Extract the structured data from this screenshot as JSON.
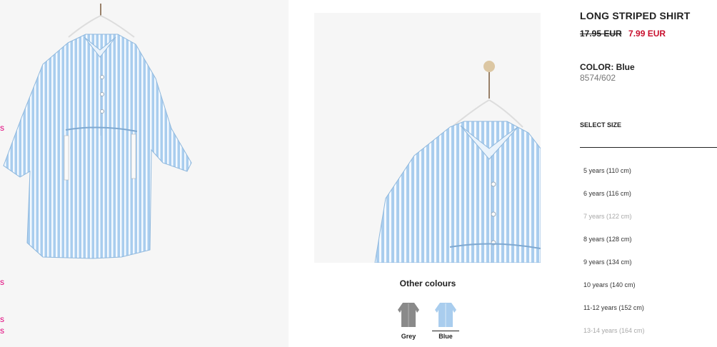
{
  "left_edge_links": [
    "s",
    "s",
    "s",
    "s"
  ],
  "product": {
    "title": "LONG STRIPED SHIRT",
    "old_price": "17.95 EUR",
    "new_price": "7.99 EUR",
    "color_label": "COLOR: Blue",
    "reference": "8574/602"
  },
  "other_colours": {
    "title": "Other colours",
    "options": [
      {
        "label": "Grey",
        "selected": false
      },
      {
        "label": "Blue",
        "selected": true
      }
    ]
  },
  "size": {
    "title": "SELECT SIZE",
    "options": [
      {
        "label": "5 years (110 cm)",
        "available": true
      },
      {
        "label": "6 years (116 cm)",
        "available": true
      },
      {
        "label": "7 years (122 cm)",
        "available": false
      },
      {
        "label": "8 years (128 cm)",
        "available": true
      },
      {
        "label": "9 years (134 cm)",
        "available": true
      },
      {
        "label": "10 years (140 cm)",
        "available": true
      },
      {
        "label": "11-12 years (152 cm)",
        "available": true
      },
      {
        "label": "13-14 years (164 cm)",
        "available": false
      }
    ]
  },
  "colors": {
    "shirt_blue": "#a9cdee",
    "stripe_white": "#f4f9fe",
    "sale_red": "#c8102e",
    "link_pink": "#e0007a",
    "grey_swatch": "#8a8a8a"
  }
}
